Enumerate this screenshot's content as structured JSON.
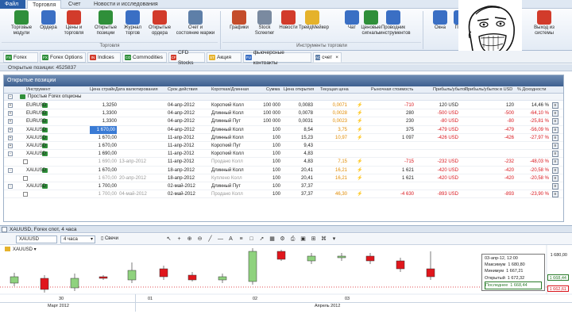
{
  "menu": {
    "file": "Файл",
    "tabs": [
      "Торговля",
      "Счет",
      "Новости и исследования"
    ],
    "active_tab": "Торговля"
  },
  "ribbon": {
    "buttons": [
      {
        "label": "Торговые\nмодули",
        "icon": "trading-modules-icon",
        "color": "#2f8f3a"
      },
      {
        "label": "Ордера",
        "icon": "orders-icon",
        "color": "#3a6fc4"
      },
      {
        "label": "Цены и\nторговля",
        "icon": "prices-icon",
        "color": "#d23b2b"
      },
      {
        "label": "Открытые\nпозиции",
        "icon": "open-positions-icon",
        "color": "#2f8f3a"
      },
      {
        "label": "Журнал\nторгов",
        "icon": "trade-journal-icon",
        "color": "#3a6fc4"
      },
      {
        "label": "Открытые\nордера",
        "icon": "open-orders-icon",
        "color": "#d23b2b"
      },
      {
        "label": "Счет и\nсостояние маржи",
        "icon": "account-margin-icon",
        "color": "#5e7fa8"
      },
      {
        "label": "Графики",
        "icon": "charts-icon",
        "color": "#c44d2b"
      },
      {
        "label": "Stock\nScreener",
        "icon": "stock-screener-icon",
        "color": "#7a8aa0"
      },
      {
        "label": "Новости",
        "icon": "news-icon",
        "color": "#d23b2b"
      },
      {
        "label": "ТрейдМейкер",
        "icon": "trademaker-icon",
        "color": "#e5b22b"
      },
      {
        "label": "Чат",
        "icon": "chat-icon",
        "color": "#3a6fc4"
      },
      {
        "label": "Ценовые\nсигналы",
        "icon": "price-signals-icon",
        "color": "#2f8f3a"
      },
      {
        "label": "Проводник\nинструментов",
        "icon": "instrument-explorer-icon",
        "color": "#3a6fc4"
      },
      {
        "label": "Окна",
        "icon": "windows-icon",
        "color": "#3a6fc4"
      },
      {
        "label": "Помо",
        "icon": "help-icon",
        "color": "#3a6fc4"
      },
      {
        "label": "Выход из\nсистемы",
        "icon": "logout-icon",
        "color": "#d23b2b"
      }
    ],
    "groups": [
      "Торговля",
      "Инструменты торговли"
    ]
  },
  "instrument_tabs": [
    {
      "label": "Forex",
      "badge": "FX",
      "badge_color": "#2f8f3a"
    },
    {
      "label": "Forex Options",
      "badge": "FX",
      "badge_color": "#2f8f3a"
    },
    {
      "label": "Indices",
      "badge": "IN",
      "badge_color": "#d23b2b"
    },
    {
      "label": "Commodities",
      "badge": "CO",
      "badge_color": "#2f8f3a"
    },
    {
      "label": "CFD Stocks",
      "badge": "CF",
      "badge_color": "#d23b2b"
    },
    {
      "label": "Акция",
      "badge": "ST",
      "badge_color": "#e5b22b"
    },
    {
      "label": "фьючерсные контракты",
      "badge": "FU",
      "badge_color": "#3a6fc4"
    },
    {
      "label": "счет",
      "badge": "AC",
      "badge_color": "#5e7fa8",
      "active": true
    }
  ],
  "positions_header": "Открытые позиции: 4525837",
  "panel": {
    "title": "Открытые позиции",
    "columns": [
      "Инструмент",
      "Цена страйк",
      "Дата валютирования",
      "Срок действия",
      "Короткая/Длинная",
      "Сумма",
      "Цена открытия",
      "Текущая цена",
      "Рыночная стоимость",
      "Прибыль/убыток",
      "Прибыль/убыток в USD",
      "% Доходности"
    ],
    "group_label": "Простые Forex опционы",
    "rows": [
      {
        "exp": "+",
        "inst": "EURUSD",
        "strike": "1,3250",
        "value_date": "",
        "expiry": "04-апр-2012",
        "side": "Короткий Колл",
        "amount": "100 000",
        "open": "0,0083",
        "current": "0,0071",
        "market": "-710",
        "pl": "120 USD",
        "pl_usd": "120",
        "ret": "14,46 %",
        "ret_red": false,
        "gray": false
      },
      {
        "exp": "+",
        "inst": "EURUSD",
        "strike": "1,3300",
        "value_date": "",
        "expiry": "04-апр-2012",
        "side": "Длинный Колл",
        "amount": "100 000",
        "open": "0,0078",
        "current": "0,0028",
        "market": "280",
        "pl": "-500 USD",
        "pl_usd": "-500",
        "ret": "-64,10 %",
        "ret_red": true,
        "gray": false
      },
      {
        "exp": "+",
        "inst": "EURUSD",
        "strike": "1,3300",
        "value_date": "",
        "expiry": "04-апр-2012",
        "side": "Длинный Пут",
        "amount": "100 000",
        "open": "0,0031",
        "current": "0,0023",
        "market": "230",
        "pl": "-80 USD",
        "pl_usd": "-80",
        "ret": "-25,81 %",
        "ret_red": true,
        "gray": false
      },
      {
        "exp": "+",
        "inst": "XAUUSD",
        "strike": "1 670,00",
        "value_date": "",
        "expiry": "04-апр-2012",
        "side": "Длинный Колл",
        "amount": "100",
        "open": "8,54",
        "current": "3,75",
        "market": "375",
        "pl": "-479 USD",
        "pl_usd": "-479",
        "ret": "-56,09 %",
        "ret_red": true,
        "gray": false,
        "selected": true
      },
      {
        "exp": "+",
        "inst": "XAUUSD",
        "strike": "1 670,00",
        "value_date": "",
        "expiry": "11-апр-2012",
        "side": "Длинный Колл",
        "amount": "100",
        "open": "15,23",
        "current": "10,97",
        "market": "1 097",
        "pl": "-426 USD",
        "pl_usd": "-426",
        "ret": "-27,97 %",
        "ret_red": true,
        "gray": false
      },
      {
        "exp": "+",
        "inst": "XAUUSD",
        "strike": "1 670,00",
        "value_date": "",
        "expiry": "11-апр-2012",
        "side": "Короткий Пут",
        "amount": "100",
        "open": "9,43",
        "current": "",
        "market": "",
        "pl": "",
        "pl_usd": "",
        "ret": "",
        "ret_red": false,
        "gray": false
      },
      {
        "exp": "-",
        "inst": "XAUUSD",
        "strike": "1 690,00",
        "value_date": "",
        "expiry": "11-апр-2012",
        "side": "Короткий Колл",
        "amount": "100",
        "open": "4,83",
        "current": "",
        "market": "",
        "pl": "",
        "pl_usd": "",
        "ret": "",
        "ret_red": false,
        "gray": false
      },
      {
        "exp": "",
        "inst": "",
        "strike": "1 690,00",
        "value_date": "13-апр-2012",
        "expiry": "11-апр-2012",
        "side": "Продано Колл",
        "amount": "100",
        "open": "4,83",
        "current": "7,15",
        "market": "-715",
        "pl": "-232 USD",
        "pl_usd": "-232",
        "ret": "-48,03 %",
        "ret_red": true,
        "gray": true
      },
      {
        "exp": "-",
        "inst": "XAUUSD",
        "strike": "1 670,00",
        "value_date": "",
        "expiry": "18-апр-2012",
        "side": "Длинный Колл",
        "amount": "100",
        "open": "20,41",
        "current": "16,21",
        "market": "1 621",
        "pl": "-420 USD",
        "pl_usd": "-420",
        "ret": "-20,58 %",
        "ret_red": true,
        "gray": false
      },
      {
        "exp": "",
        "inst": "",
        "strike": "1 670,00",
        "value_date": "20-апр-2012",
        "expiry": "18-апр-2012",
        "side": "Куплено Колл",
        "amount": "100",
        "open": "20,41",
        "current": "16,21",
        "market": "1 621",
        "pl": "-420 USD",
        "pl_usd": "-420",
        "ret": "-20,58 %",
        "ret_red": true,
        "gray": true
      },
      {
        "exp": "-",
        "inst": "XAUUSD",
        "strike": "1 700,00",
        "value_date": "",
        "expiry": "02-май-2012",
        "side": "Длинный Пут",
        "amount": "100",
        "open": "37,37",
        "current": "",
        "market": "",
        "pl": "",
        "pl_usd": "",
        "ret": "",
        "ret_red": false,
        "gray": false
      },
      {
        "exp": "",
        "inst": "",
        "strike": "1 700,00",
        "value_date": "04-май-2012",
        "expiry": "02-май-2012",
        "side": "Продано Колл",
        "amount": "100",
        "open": "37,37",
        "current": "46,30",
        "market": "-4 630",
        "pl": "-893 USD",
        "pl_usd": "-893",
        "ret": "-23,90 %",
        "ret_red": true,
        "gray": true
      }
    ]
  },
  "chart": {
    "header": "XAUUSD, Forex спот, 4 часа",
    "instrument_select": "XAUUSD",
    "timeframe_select": "4 часа",
    "style_select": "Свечи",
    "series_label": "XAUUSD",
    "tooltip": {
      "date": "03-апр-12, 12:00",
      "rows": [
        {
          "label": "Максимум",
          "value": "1 680,80"
        },
        {
          "label": "Минимум",
          "value": "1 667,21"
        },
        {
          "label": "Открытый",
          "value": "1 672,32"
        },
        {
          "label": "Последнее",
          "value": "1 668,44"
        }
      ]
    },
    "price_labels": [
      "1 680,00",
      "1 668,44",
      "1 662,61"
    ],
    "x_day_labels": [
      "30",
      "01",
      "02",
      "03"
    ],
    "x_month_labels": [
      "Март 2012",
      "Апрель 2012"
    ]
  },
  "colors": {
    "up": "#8fd27e",
    "down": "#e0161c",
    "accent": "#2b5fa8",
    "loss": "#d8141b"
  }
}
